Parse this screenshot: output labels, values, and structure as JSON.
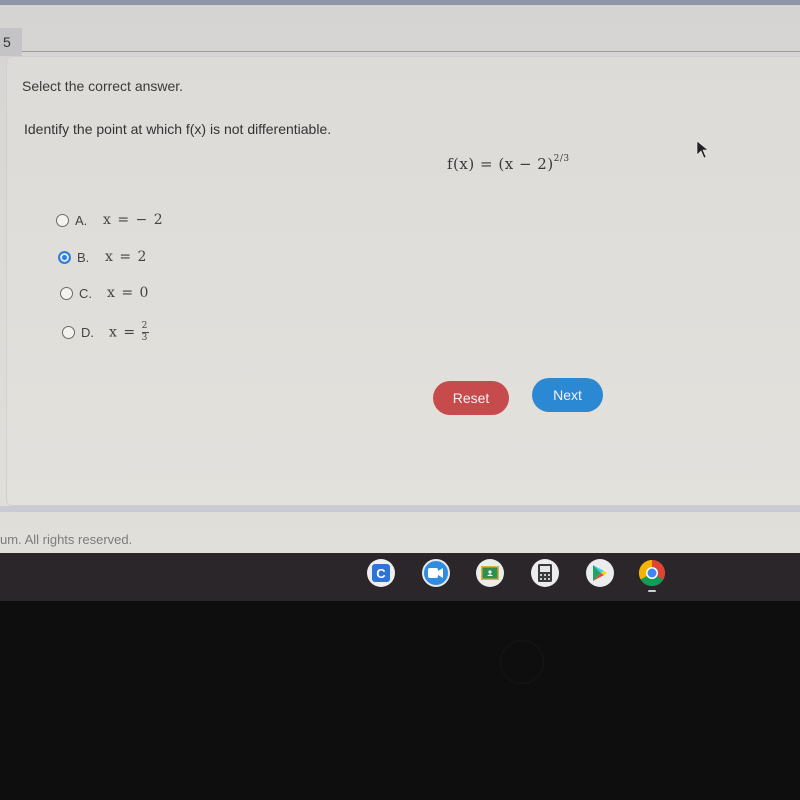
{
  "question": {
    "number": "5",
    "instruction": "Select the correct answer.",
    "prompt": "Identify the point at which f(x) is not differentiable.",
    "formula": {
      "lhs": "f(x)",
      "equals": "=",
      "rhs_base": "(x − 2)",
      "exponent": "2/3"
    },
    "options": [
      {
        "letter": "A.",
        "value": "x = − 2",
        "selected": false
      },
      {
        "letter": "B.",
        "value": "x = 2",
        "selected": true
      },
      {
        "letter": "C.",
        "value": "x = 0",
        "selected": false
      },
      {
        "letter": "D.",
        "value_prefix": "x =",
        "frac_num": "2",
        "frac_den": "3",
        "selected": false
      }
    ]
  },
  "buttons": {
    "reset_label": "Reset",
    "next_label": "Next",
    "reset_color": "#c74a4c",
    "next_color": "#2b88d3"
  },
  "footer": {
    "copyright": "um. All rights reserved."
  },
  "shelf": {
    "apps": [
      {
        "name": "Classkick",
        "icon": "classkick-icon",
        "glyph": "C"
      },
      {
        "name": "Zoom",
        "icon": "zoom-video-icon"
      },
      {
        "name": "Google Classroom",
        "icon": "google-classroom-icon"
      },
      {
        "name": "Calculator",
        "icon": "calculator-icon"
      },
      {
        "name": "Play Store",
        "icon": "play-store-icon"
      },
      {
        "name": "Chrome",
        "icon": "chrome-icon",
        "active": true
      }
    ]
  },
  "colors": {
    "accent_selected": "#2f7fd8",
    "shelf_bg": "#2b2629"
  }
}
